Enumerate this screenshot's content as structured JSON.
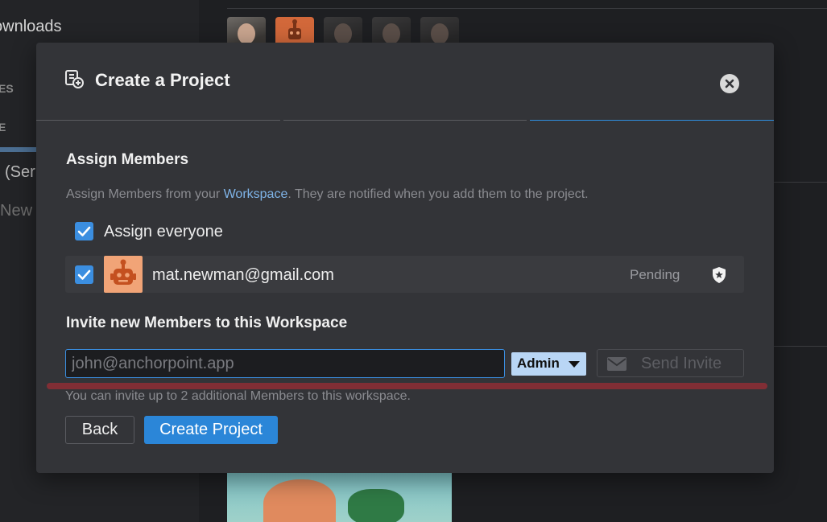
{
  "background": {
    "sidebar_items": [
      "ownloads",
      "ES",
      "E",
      "(Ser",
      "New"
    ]
  },
  "modal": {
    "title": "Create a Project",
    "header_icon": "project-add-icon",
    "close_icon": "close-icon",
    "steps": [
      {
        "state": "done"
      },
      {
        "state": "done"
      },
      {
        "state": "active"
      }
    ],
    "assign": {
      "title": "Assign Members",
      "description_prefix": "Assign Members from your ",
      "description_link": "Workspace",
      "description_suffix": ". They are notified when you add them to the project.",
      "assign_everyone_label": "Assign everyone",
      "assign_everyone_checked": true,
      "members": [
        {
          "email": "mat.newman@gmail.com",
          "status": "Pending",
          "checked": true,
          "avatar": "robot-avatar",
          "role_icon": "shield-star-icon"
        }
      ]
    },
    "invite": {
      "title": "Invite new Members to this Workspace",
      "input_placeholder": "john@anchorpoint.app",
      "input_value": "",
      "role_selected": "Admin",
      "send_label": "Send Invite",
      "send_icon": "envelope-icon",
      "note": "You can invite up to 2 additional Members to this workspace."
    },
    "buttons": {
      "back_label": "Back",
      "create_label": "Create Project"
    }
  },
  "colors": {
    "accent": "#2b86d8",
    "annotation": "#8a2e35"
  }
}
